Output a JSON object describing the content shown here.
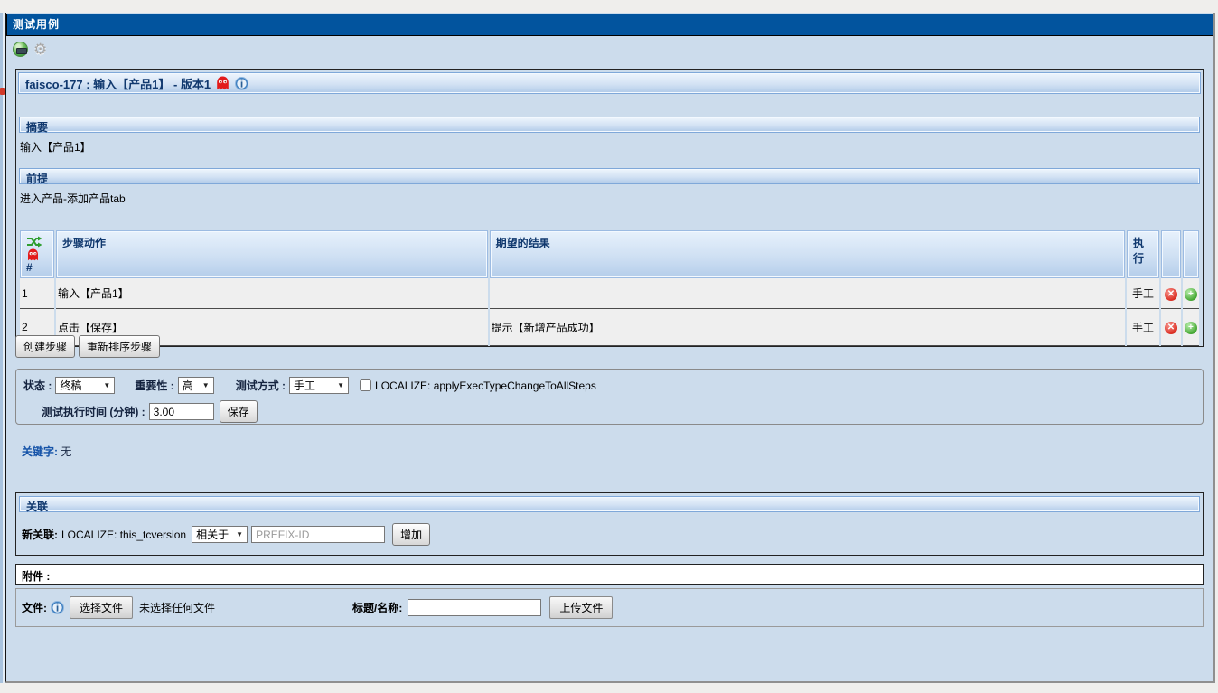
{
  "window": {
    "title": "测试用例"
  },
  "toolbar": {
    "icons": [
      "world-edit-icon",
      "settings-icon"
    ]
  },
  "testcase": {
    "title": "faisco-177 : 输入【产品1】 - 版本1",
    "summary_label": "摘要",
    "summary_text": "输入【产品1】",
    "precondition_label": "前提",
    "precondition_text": "进入产品-添加产品tab"
  },
  "steps_table": {
    "header": {
      "num": "#",
      "action": "步骤动作",
      "expected": "期望的结果",
      "exec": "执行"
    },
    "rows": [
      {
        "num": "1",
        "action": "输入【产品1】",
        "expected": "",
        "exec_type": "手工"
      },
      {
        "num": "2",
        "action": "点击【保存】",
        "expected": "提示【新增产品成功】",
        "exec_type": "手工"
      }
    ]
  },
  "step_buttons": {
    "create": "创建步骤",
    "reorder": "重新排序步骤"
  },
  "attributes_form": {
    "status_label": "状态 :",
    "status_value": "终稿",
    "importance_label": "重要性 :",
    "importance_value": "高",
    "exec_type_label": "测试方式 :",
    "exec_type_value": "手工",
    "apply_checkbox_label": "LOCALIZE: applyExecTypeChangeToAllSteps",
    "duration_label": "测试执行时间 (分钟) :",
    "duration_value": "3.00",
    "save_button": "保存"
  },
  "keywords": {
    "label": "关键字:",
    "value": "无"
  },
  "relations": {
    "header": "关联",
    "new_label": "新关联:",
    "scope_text": "LOCALIZE: this_tcversion",
    "relation_type_value": "相关于",
    "input_placeholder": "PREFIX-ID",
    "add_button": "增加"
  },
  "attachments": {
    "header": "附件 :",
    "file_label": "文件:",
    "choose_button": "选择文件",
    "no_file_text": "未选择任何文件",
    "title_label": "标题/名称:",
    "title_value": "",
    "upload_button": "上传文件"
  },
  "colors": {
    "titlebar": "#02549e",
    "page_bg": "#ccdcec",
    "section_header_text": "#10386e",
    "keyword_link": "#1553a8",
    "ghost_icon": "#e31b1b",
    "delete_icon": "#dc2f23",
    "add_icon": "#46a834"
  }
}
